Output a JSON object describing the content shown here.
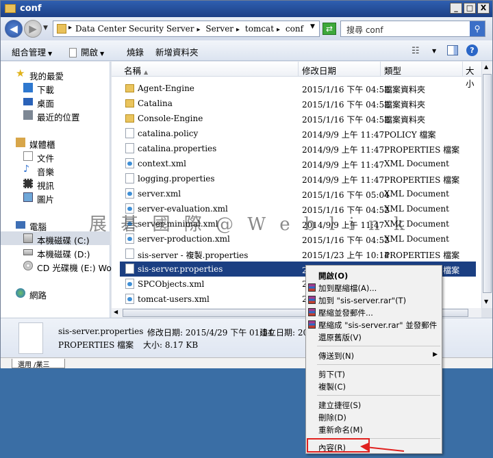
{
  "window": {
    "title": "conf",
    "buttons": [
      "_",
      "□",
      "X"
    ]
  },
  "address": {
    "crumbs": [
      "Data Center Security Server",
      "Server",
      "tomcat",
      "conf"
    ],
    "search_placeholder": "搜尋 conf"
  },
  "toolbar": {
    "organize": "組合管理",
    "open": "開啟",
    "burn": "燒錄",
    "new_folder": "新增資料夾"
  },
  "nav": {
    "favorites": "我的最愛",
    "downloads": "下載",
    "desktop": "桌面",
    "recent": "最近的位置",
    "libraries": "媒體櫃",
    "documents": "文件",
    "music": "音樂",
    "videos": "視訊",
    "pictures": "圖片",
    "computer": "電腦",
    "drive_c": "本機磁碟 (C:)",
    "drive_d": "本機磁碟 (D:)",
    "drive_e": "CD 光碟機 (E:) Worm",
    "network": "網路"
  },
  "columns": {
    "name": "名稱",
    "date": "修改日期",
    "type": "類型",
    "size": "大小"
  },
  "files": [
    {
      "name": "Agent-Engine",
      "date": "2015/1/16 下午 04:52",
      "type": "檔案資料夾",
      "icon": "folder"
    },
    {
      "name": "Catalina",
      "date": "2015/1/16 下午 04:52",
      "type": "檔案資料夾",
      "icon": "folder"
    },
    {
      "name": "Console-Engine",
      "date": "2015/1/16 下午 04:52",
      "type": "檔案資料夾",
      "icon": "folder"
    },
    {
      "name": "catalina.policy",
      "date": "2014/9/9 上午 11:47",
      "type": "POLICY 檔案",
      "icon": "doc"
    },
    {
      "name": "catalina.properties",
      "date": "2014/9/9 上午 11:47",
      "type": "PROPERTIES 檔案",
      "icon": "doc"
    },
    {
      "name": "context.xml",
      "date": "2014/9/9 上午 11:47",
      "type": "XML Document",
      "icon": "xml"
    },
    {
      "name": "logging.properties",
      "date": "2014/9/9 上午 11:47",
      "type": "PROPERTIES 檔案",
      "icon": "doc"
    },
    {
      "name": "server.xml",
      "date": "2015/1/16 下午 05:04",
      "type": "XML Document",
      "icon": "xml"
    },
    {
      "name": "server-evaluation.xml",
      "date": "2015/1/16 下午 04:52",
      "type": "XML Document",
      "icon": "xml"
    },
    {
      "name": "server-minimal.xml",
      "date": "2014/9/9 上午 11:47",
      "type": "XML Document",
      "icon": "xml"
    },
    {
      "name": "server-production.xml",
      "date": "2015/1/16 下午 04:52",
      "type": "XML Document",
      "icon": "xml"
    },
    {
      "name": "sis-server - 複製.properties",
      "date": "2015/1/23 上午 10:14",
      "type": "PROPERTIES 檔案",
      "icon": "doc"
    },
    {
      "name": "sis-server.properties",
      "date": "2015/4/29 下午 01:54",
      "type": "PROPERTIES 檔案",
      "icon": "doc",
      "selected": true
    },
    {
      "name": "SPCObjects.xml",
      "date": "2",
      "type": "",
      "icon": "xml"
    },
    {
      "name": "tomcat-users.xml",
      "date": "2",
      "type": "",
      "icon": "xml"
    }
  ],
  "details": {
    "filename": "sis-server.properties",
    "modified_label": "修改日期: 2015/4/29 下午 01:54",
    "created_label": "建立日期: 20",
    "type": "PROPERTIES 檔案",
    "size_label": "大小: 8.17 KB"
  },
  "tabstrip": {
    "tab": "選用 /業三"
  },
  "watermark": "展 碁 國 際 @ W e b l i n k",
  "context_menu": {
    "open": "開啟(O)",
    "add_archive": "加到壓縮檔(A)...",
    "add_rar": "加到 \"sis-server.rar\"(T)",
    "compress_email": "壓縮並發郵件...",
    "compress_rar_email": "壓縮成 \"sis-server.rar\" 並發郵件",
    "restore": "還原舊版(V)",
    "send_to": "傳送到(N)",
    "cut": "剪下(T)",
    "copy": "複製(C)",
    "shortcut": "建立捷徑(S)",
    "delete": "刪除(D)",
    "rename": "重新命名(M)",
    "properties": "內容(R)"
  },
  "colors": {
    "selection": "#1b3f82",
    "highlight_box": "#e0201e",
    "desktop": "#3a6ea5"
  }
}
